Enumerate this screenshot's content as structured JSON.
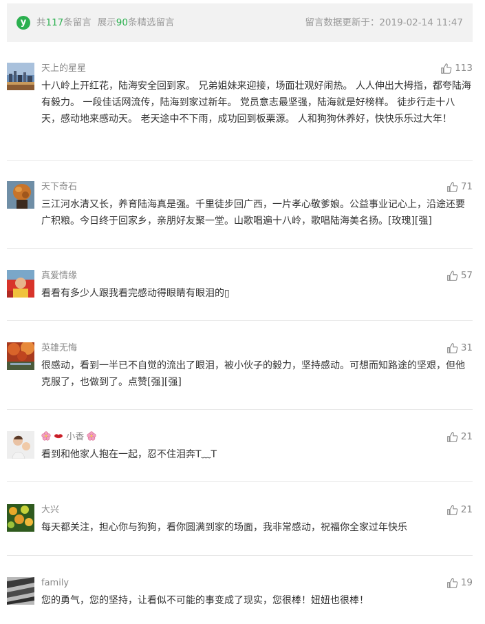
{
  "header": {
    "prefix_total": "共",
    "total_count": "117",
    "suffix_total": "条留言",
    "prefix_shown": "展示",
    "shown_count": "90",
    "suffix_shown": "条精选留言",
    "updated_text": "留言数据更新于：2019-02-14 11:47",
    "logo_glyph": "y",
    "accent_color": "#2bb04f"
  },
  "comments": [
    {
      "nickname": "天上的星星",
      "likes": "113",
      "text": "十八岭上开红花，陆海安全回到家。 兄弟姐妹来迎接，场面壮观好闹热。 人人伸出大拇指，都夸陆海有毅力。 一段佳话网流传，陆海到家过新年。 党员意志最坚强，陆海就是好榜样。 徒步行走十八天，感动地来感动天。 老天途中不下雨，成功回到板栗源。 人和狗狗休养好，快快乐乐过大年！"
    },
    {
      "nickname": "天下奇石",
      "likes": "71",
      "text": "三江河水清又长，养育陆海真是强。千里徒步回广西，一片孝心敬爹娘。公益事业记心上，沿途还要广积粮。今日终于回家乡，亲朋好友聚一堂。山歌唱遍十八岭，歌唱陆海美名扬。[玫瑰][强]"
    },
    {
      "nickname": "真爱情缘",
      "likes": "57",
      "text": "看看有多少人跟我看完感动得眼睛有眼泪的▯"
    },
    {
      "nickname": "英雄无悔",
      "likes": "31",
      "text": "很感动，看到一半已不自觉的流出了眼泪，被小伙子的毅力，坚持感动。可想而知路途的坚艰，但他克服了，也做到了。点赞[强][强]"
    },
    {
      "nickname": "小香",
      "likes": "21",
      "text": "看到和他家人抱在一起，忍不住泪奔T﹏T"
    },
    {
      "nickname": "大兴",
      "likes": "21",
      "text": "每天都关注，担心你与狗狗，看你圆满到家的场面，我非常感动，祝福你全家过年快乐"
    },
    {
      "nickname": "family",
      "likes": "19",
      "text": "您的勇气，您的坚持，让看似不可能的事变成了现实，您很棒！妞妞也很棒！"
    }
  ]
}
